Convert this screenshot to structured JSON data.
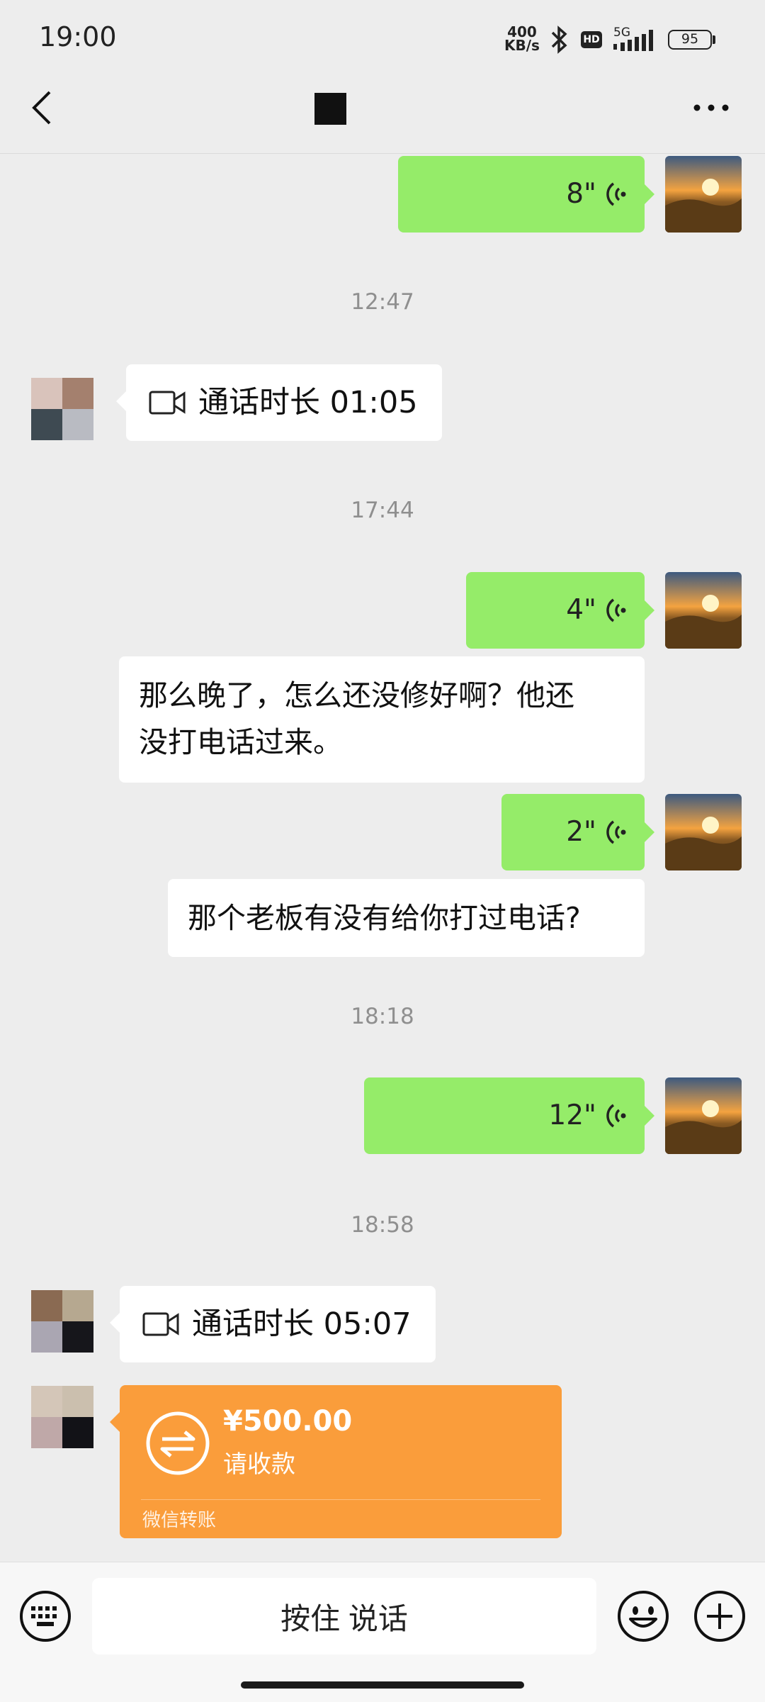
{
  "status_bar": {
    "time": "19:00",
    "speed_value": "400",
    "speed_unit": "KB/s",
    "hd": "HD",
    "network": "5G",
    "battery": "95"
  },
  "header": {
    "back_icon": "chevron-left-icon",
    "more_icon": "more-dots-icon"
  },
  "messages": {
    "m1": {
      "duration": "8\""
    },
    "ts1": "12:47",
    "call1": {
      "text": "通话时长 01:05"
    },
    "ts2": "17:44",
    "m2": {
      "duration": "4\""
    },
    "m3": {
      "text_line1": "那么晚了，怎么还没修好啊？他还",
      "text_line2": "没打电话过来。"
    },
    "m4": {
      "duration": "2\""
    },
    "m5": {
      "text": "那个老板有没有给你打过电话?"
    },
    "ts3": "18:18",
    "m6": {
      "duration": "12\""
    },
    "ts4": "18:58",
    "call2": {
      "text": "通话时长 05:07"
    },
    "transfer": {
      "amount": "¥500.00",
      "status": "请收款",
      "footer": "微信转账"
    }
  },
  "input_bar": {
    "hold_to_talk": "按住 说话",
    "keyboard_icon": "keyboard-icon",
    "emoji_icon": "emoji-icon",
    "plus_icon": "plus-icon"
  },
  "colors": {
    "bubble_green": "#95ec69",
    "transfer_orange": "#fa9d3b",
    "background": "#ededed"
  }
}
